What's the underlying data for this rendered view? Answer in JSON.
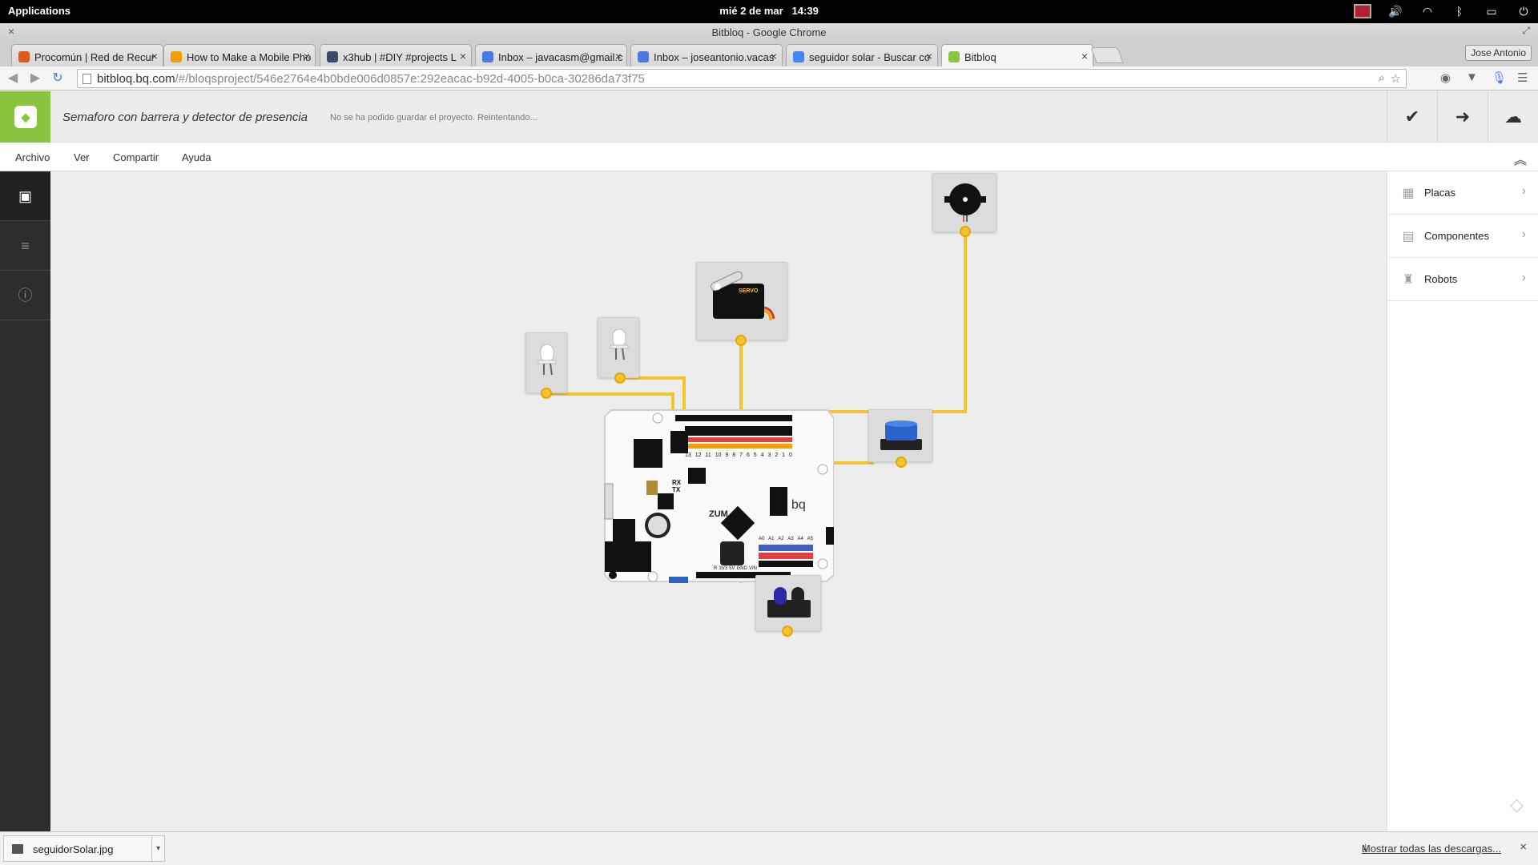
{
  "os": {
    "apps_label": "Applications",
    "date": "mié  2 de mar",
    "time": "14:39"
  },
  "window": {
    "title": "Bitbloq - Google Chrome"
  },
  "tabs": [
    {
      "title": "Procomún | Red de Recur",
      "favicon": "procomun",
      "color": "#e05a1a"
    },
    {
      "title": "How to Make a Mobile Pho",
      "favicon": "instructables",
      "color": "#f0a000"
    },
    {
      "title": "x3hub | #DIY #projects L",
      "favicon": "x3hub",
      "color": "#3a4a6a"
    },
    {
      "title": "Inbox – javacasm@gmail.c",
      "favicon": "inbox",
      "color": "#4a7ae0"
    },
    {
      "title": "Inbox – joseantonio.vacas",
      "favicon": "inbox",
      "color": "#4a7ae0"
    },
    {
      "title": "seguidor solar - Buscar co",
      "favicon": "google",
      "color": "#4285f4"
    },
    {
      "title": "Bitbloq",
      "favicon": "bitbloq",
      "color": "#8ac53f"
    }
  ],
  "user_button": "Jose Antonio",
  "address": {
    "host": "bitbloq.bq.com",
    "path": "/#/bloqsproject/546e2764e4b0bde006d0857e:292eacac-b92d-4005-b0ca-30286da73f75"
  },
  "app": {
    "project_name": "Semaforo con barrera y detector de presencia",
    "status": "No se ha podido guardar el proyecto. Reintentando...",
    "brand_color": "#8ac53f"
  },
  "menu": {
    "items": [
      "Archivo",
      "Ver",
      "Compartir",
      "Ayuda"
    ]
  },
  "right_panel": {
    "items": [
      {
        "label": "Placas",
        "icon": "board-icon"
      },
      {
        "label": "Componentes",
        "icon": "components-icon"
      },
      {
        "label": "Robots",
        "icon": "robot-icon"
      }
    ]
  },
  "board": {
    "name_label": "ZUM",
    "brand": "bq",
    "digital_pins": [
      "13",
      "12",
      "11",
      "10",
      "9",
      "8",
      "7",
      "6",
      "5",
      "4",
      "3",
      "2",
      "1",
      "0"
    ],
    "analog_pins": [
      "A0",
      "A1",
      "A2",
      "A3",
      "A4",
      "A5"
    ],
    "power_pins": [
      "R",
      "3V3",
      "5V",
      "GND",
      "VIN"
    ],
    "rx_label": "RX",
    "tx_label": "TX"
  },
  "components": {
    "servo_label": "SERVO",
    "wire_color": "#f3c330"
  },
  "downloads": {
    "file": "seguidorSolar.jpg",
    "show_all": "Mostrar todas las descargas..."
  }
}
